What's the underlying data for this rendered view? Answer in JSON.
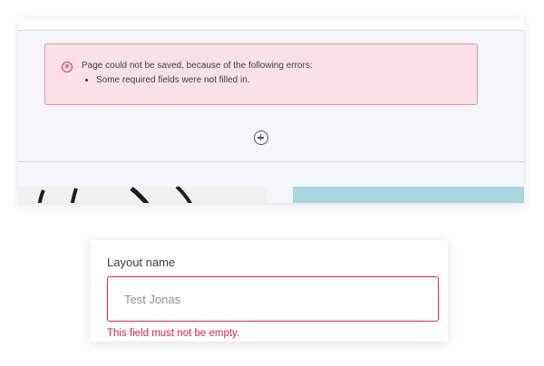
{
  "editor": {
    "error_box": {
      "title": "Page could not be saved, because of the following errors:",
      "items": [
        "Some required fields were not filled in."
      ]
    },
    "add_section_icon": "plus-circle-icon"
  },
  "form": {
    "layout_name_label": "Layout name",
    "layout_name_value": "Test Jonas",
    "layout_name_error": "This field must not be empty."
  },
  "colors": {
    "error_border": "#e0284e",
    "error_text": "#d8234a",
    "error_box_bg": "#fbe1e7",
    "thumbnail_blue": "#a9d7e2"
  }
}
